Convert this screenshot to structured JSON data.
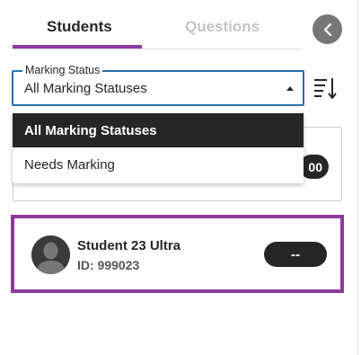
{
  "tabs": [
    {
      "label": "Students",
      "active": true
    },
    {
      "label": "Questions",
      "active": false
    }
  ],
  "back_button": {
    "icon": "chevron-left-icon"
  },
  "filter": {
    "legend": "Marking Status",
    "value": "All Marking Statuses",
    "options": [
      "All Marking Statuses",
      "Needs Marking"
    ],
    "selected_index": 0
  },
  "sort_button": {
    "icon": "sort-descending-icon"
  },
  "hidden_card": {
    "grade": "00"
  },
  "student": {
    "name": "Student 23 Ultra",
    "id_text": "ID: 999023",
    "grade": "--"
  },
  "colors": {
    "accent_purple": "#8e3a9d",
    "focus_blue": "#2a6fb0",
    "dark": "#262626",
    "muted_tab": "#c4c4c4"
  }
}
